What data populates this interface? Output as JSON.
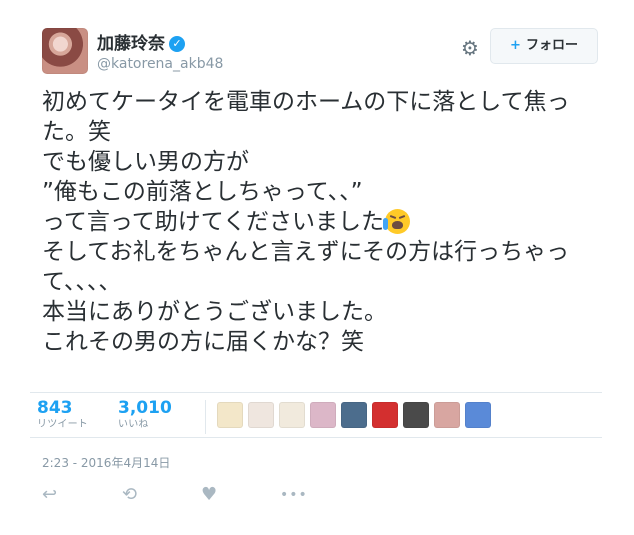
{
  "user": {
    "display_name": "加藤玲奈",
    "handle": "@katorena_akb48",
    "verified_mark": "✓",
    "avatar_icon": "profile-avatar"
  },
  "actions_top": {
    "settings_icon": "⚙",
    "follow_icon": "+",
    "follow_label": "フォロー"
  },
  "tweet": {
    "text_main": "初めてケータイを電車のホームの下に落として焦った。笑\nでも優しい男の方が\n”俺もこの前落としちゃって、、”\nって言って助けてくださいました",
    "text_rest": "\nそしてお礼をちゃんと言えずにその方は行っちゃって、、、、\n本当にありがとうございました。\nこれその男の方に届くかな？笑",
    "emoji_name": "crying-face"
  },
  "stats": {
    "retweets": {
      "value": "843",
      "label": "リツイート"
    },
    "likes": {
      "value": "3,010",
      "label": "いいね"
    }
  },
  "liker_avatars": [
    {
      "name": "avatar-1",
      "color": "#f3e7c9"
    },
    {
      "name": "avatar-2",
      "color": "#efe6df"
    },
    {
      "name": "avatar-3",
      "color": "#f1eadd"
    },
    {
      "name": "avatar-4",
      "color": "#dcb7c8"
    },
    {
      "name": "avatar-5",
      "color": "#4c6d8d"
    },
    {
      "name": "avatar-6",
      "color": "#d32f2f"
    },
    {
      "name": "avatar-7",
      "color": "#4a4a4a"
    },
    {
      "name": "avatar-8",
      "color": "#d8a6a1"
    },
    {
      "name": "avatar-9",
      "color": "#5a8ad8"
    }
  ],
  "timestamp": "2:23 - 2016年4月14日",
  "bottom_actions": {
    "reply_icon": "↩",
    "retweet_icon": "⟲",
    "like_icon": "♥",
    "more_icon": "•••"
  },
  "colors": {
    "accent": "#1da1f2",
    "text": "#292f33",
    "muted": "#8899a6",
    "border": "#e1e8ed"
  }
}
